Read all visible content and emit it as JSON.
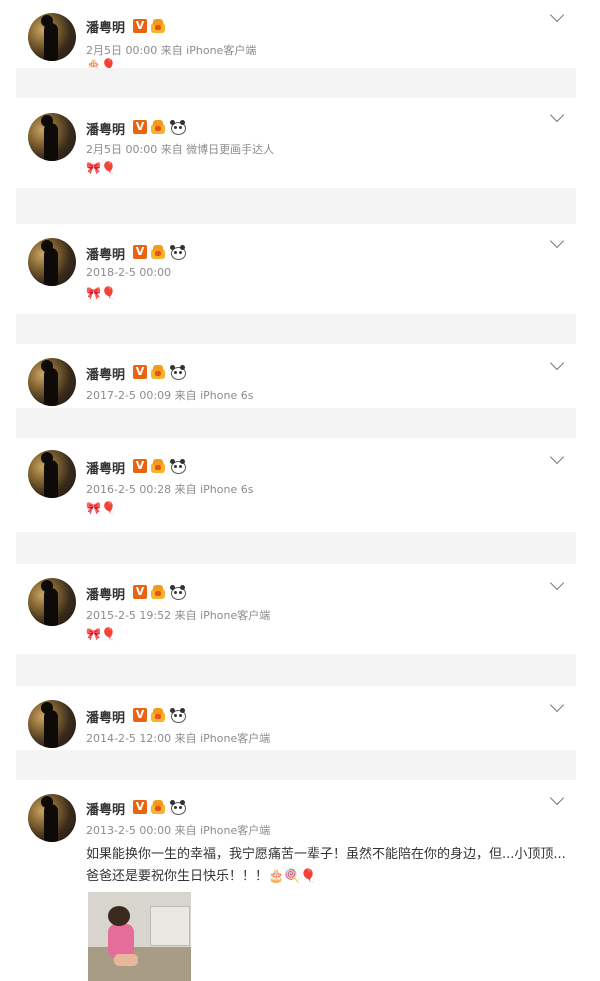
{
  "posts": [
    {
      "name": "潘粤明",
      "meta": "2月5日 00:00 来自 iPhone客户端",
      "emoji": "🎂🎈",
      "panda": false
    },
    {
      "name": "潘粤明",
      "meta": "2月5日 00:00 来自 微博日更画手达人",
      "emoji": "🎀🎈",
      "panda": true
    },
    {
      "name": "潘粤明",
      "meta": "2018-2-5 00:00",
      "emoji": "🎀🎈",
      "panda": true
    },
    {
      "name": "潘粤明",
      "meta": "2017-2-5 00:09 来自 iPhone 6s",
      "emoji": "",
      "panda": true
    },
    {
      "name": "潘粤明",
      "meta": "2016-2-5 00:28 来自 iPhone 6s",
      "emoji": "🎀🎈",
      "panda": true
    },
    {
      "name": "潘粤明",
      "meta": "2015-2-5 19:52 来自 iPhone客户端",
      "emoji": "🎀🎈",
      "panda": true
    },
    {
      "name": "潘粤明",
      "meta": "2014-2-5 12:00 来自 iPhone客户端",
      "emoji": "",
      "panda": true
    },
    {
      "name": "潘粤明",
      "meta": "2013-2-5 00:00 来自 iPhone客户端",
      "emoji": "",
      "panda": true
    }
  ],
  "last_post_text": "如果能换你一生的幸福，我宁愿痛苦一辈子！虽然不能陪在你的身边，但...小顶顶...爸爸还是要祝你生日快乐！！！🎂🍭🎈",
  "icons": {
    "verified": "V",
    "crown": "crown-icon",
    "panda": "panda-icon",
    "more": "chevron-down-icon"
  },
  "colors": {
    "verified": "#e86412",
    "meta": "#8c8c8c",
    "gap": "#f4f4f4"
  }
}
